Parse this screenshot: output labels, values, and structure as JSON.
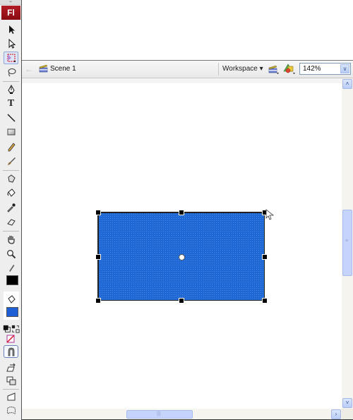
{
  "app": {
    "logo_text": "Fl"
  },
  "tools_panel": {
    "grip": "••",
    "tools": [
      {
        "name": "selection-tool",
        "active": false
      },
      {
        "name": "subselection-tool",
        "active": false
      },
      {
        "name": "free-transform-tool",
        "active": true
      },
      {
        "name": "lasso-tool",
        "active": false
      },
      {
        "name": "pen-tool",
        "active": false
      },
      {
        "name": "text-tool",
        "glyph": "T",
        "active": false
      },
      {
        "name": "line-tool",
        "active": false
      },
      {
        "name": "rectangle-tool",
        "active": false
      },
      {
        "name": "pencil-tool",
        "active": false
      },
      {
        "name": "brush-tool",
        "active": false
      },
      {
        "name": "ink-bottle-tool",
        "active": false
      },
      {
        "name": "paint-bucket-tool",
        "active": false
      },
      {
        "name": "eyedropper-tool",
        "active": false
      },
      {
        "name": "eraser-tool",
        "active": false
      },
      {
        "name": "hand-tool",
        "active": false
      },
      {
        "name": "zoom-tool",
        "active": false
      }
    ],
    "stroke_color": "#000000",
    "fill_color": "#1f5fd6",
    "options": [
      "snap-to-objects",
      "smooth",
      "straighten",
      "rotate-and-skew",
      "scale",
      "distort",
      "envelope"
    ]
  },
  "edit_bar": {
    "back_arrow": "←",
    "scene_label": "Scene 1",
    "workspace_label": "Workspace ▾",
    "zoom_value": "142%",
    "zoom_dropdown_glyph": "∨"
  },
  "scrollbars": {
    "up_glyph": "˄",
    "down_glyph": "˅",
    "right_glyph": "›",
    "grip_v": "≡",
    "grip_h": "|||"
  },
  "stage": {
    "shape": {
      "type": "rectangle",
      "fill_color": "#1f67d4",
      "stroke_color": "#222222",
      "selected": true
    }
  }
}
